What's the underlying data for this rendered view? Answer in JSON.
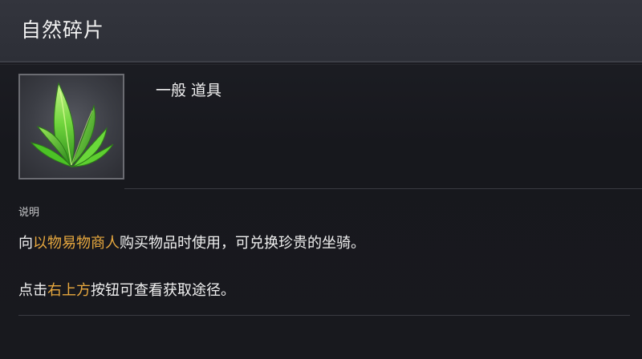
{
  "item": {
    "title": "自然碎片",
    "type_label": "一般 道具",
    "icon": "green-leaf-sprout-icon"
  },
  "description": {
    "label": "说明",
    "line1": {
      "pre": "向",
      "highlight": "以物易物商人",
      "post": "购买物品时使用，可兑换珍贵的坐骑。"
    },
    "line2": {
      "pre": "点击",
      "highlight": "右上方",
      "post": "按钮可查看获取途径。"
    }
  },
  "colors": {
    "highlight": "#e9a93f",
    "text": "#f0f0f0",
    "header_bg": "#2f3139",
    "panel_bg": "#18191e"
  }
}
